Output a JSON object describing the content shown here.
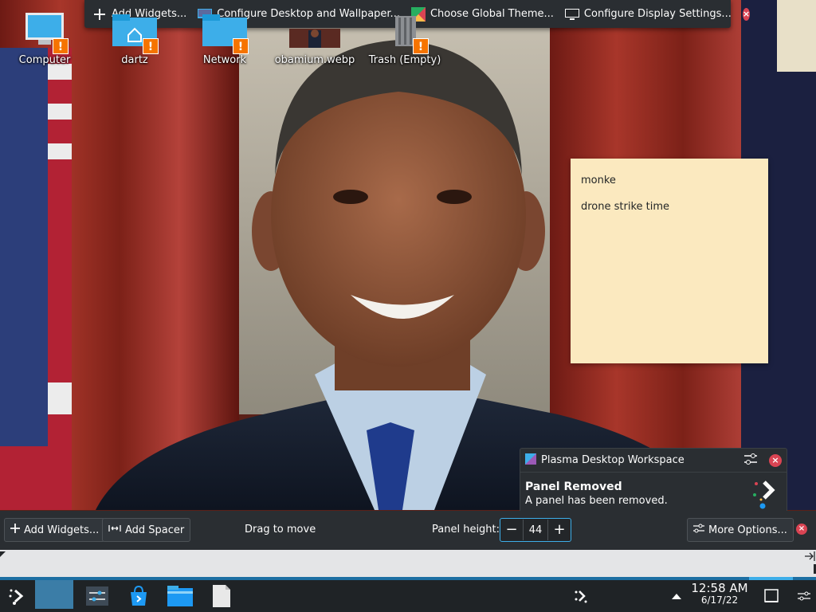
{
  "desktop_toolbar": {
    "add_widgets": "Add Widgets...",
    "configure_desktop": "Configure Desktop and Wallpaper...",
    "global_theme": "Choose Global Theme...",
    "display_settings": "Configure Display Settings..."
  },
  "desktop_icons": {
    "computer": "Computer",
    "dartz": "dartz",
    "network": "Network",
    "obamium": "obamium.webp",
    "trash": "Trash (Empty)"
  },
  "sticky_note": {
    "line1": "monke",
    "line2": "drone strike time"
  },
  "notification": {
    "app_name": "Plasma Desktop Workspace",
    "title": "Panel Removed",
    "message": "A panel has been removed."
  },
  "panel_edit": {
    "add_widgets": "Add Widgets...",
    "add_spacer": "Add Spacer",
    "drag_to_move": "Drag to move",
    "panel_height_label": "Panel height:",
    "panel_height_value": "44",
    "minus": "−",
    "plus": "+",
    "more_options": "More Options..."
  },
  "taskbar": {
    "time": "12:58 AM",
    "date": "6/17/22"
  },
  "colors": {
    "accent": "#3daee9",
    "panel_bg": "#2a2e32",
    "close_red": "#da4453",
    "warning_orange": "#f67400",
    "note_bg": "#fbe9bf"
  },
  "icons": {
    "desktop_toolbar": [
      "plus-icon",
      "configure-desktop-icon",
      "global-theme-icon",
      "display-icon",
      "close-icon"
    ],
    "taskbar": [
      "application-launcher-icon",
      "pager-icon",
      "system-settings-icon",
      "discover-icon",
      "dolphin-icon",
      "document-icon",
      "kdeconnect-icon",
      "tray-expand-icon",
      "show-desktop-icon",
      "panel-settings-icon"
    ]
  }
}
